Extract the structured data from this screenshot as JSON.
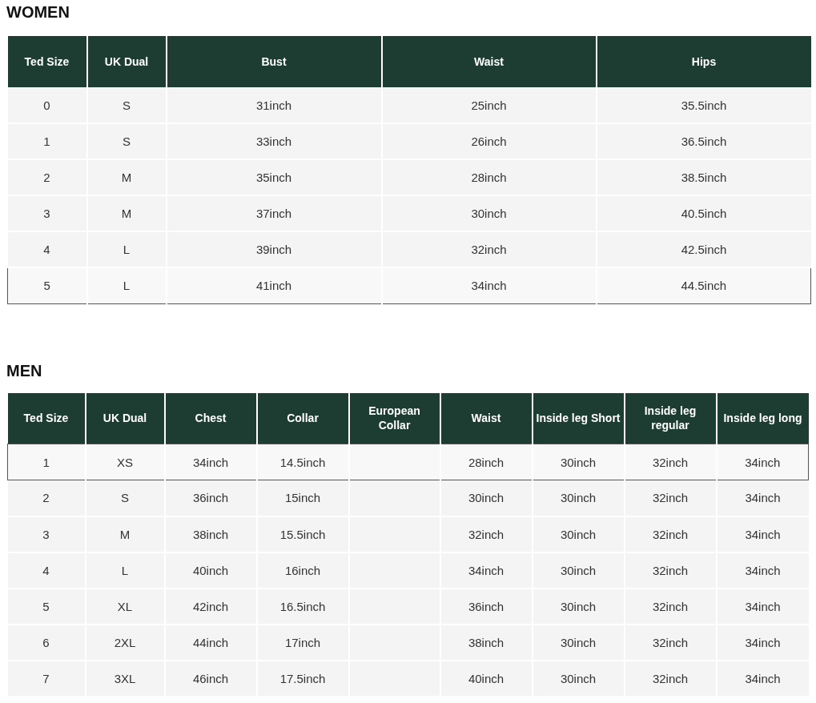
{
  "sections": [
    {
      "title": "WOMEN",
      "columns": [
        "Ted Size",
        "UK Dual",
        "Bust",
        "Waist",
        "Hips"
      ],
      "rows": [
        {
          "highlighted": false,
          "cells": [
            "0",
            "S",
            "31inch",
            "25inch",
            "35.5inch"
          ]
        },
        {
          "highlighted": false,
          "cells": [
            "1",
            "S",
            "33inch",
            "26inch",
            "36.5inch"
          ]
        },
        {
          "highlighted": false,
          "cells": [
            "2",
            "M",
            "35inch",
            "28inch",
            "38.5inch"
          ]
        },
        {
          "highlighted": false,
          "cells": [
            "3",
            "M",
            "37inch",
            "30inch",
            "40.5inch"
          ]
        },
        {
          "highlighted": false,
          "cells": [
            "4",
            "L",
            "39inch",
            "32inch",
            "42.5inch"
          ]
        },
        {
          "highlighted": true,
          "cells": [
            "5",
            "L",
            "41inch",
            "34inch",
            "44.5inch"
          ]
        }
      ]
    },
    {
      "title": "MEN",
      "columns": [
        "Ted Size",
        "UK Dual",
        "Chest",
        "Collar",
        "European Collar",
        "Waist",
        "Inside leg Short",
        "Inside leg regular",
        "Inside leg long"
      ],
      "rows": [
        {
          "highlighted": true,
          "cells": [
            "1",
            "XS",
            "34inch",
            "14.5inch",
            null,
            "28inch",
            "30inch",
            "32inch",
            "34inch"
          ]
        },
        {
          "highlighted": false,
          "cells": [
            "2",
            "S",
            "36inch",
            "15inch",
            null,
            "30inch",
            "30inch",
            "32inch",
            "34inch"
          ]
        },
        {
          "highlighted": false,
          "cells": [
            "3",
            "M",
            "38inch",
            "15.5inch",
            null,
            "32inch",
            "30inch",
            "32inch",
            "34inch"
          ]
        },
        {
          "highlighted": false,
          "cells": [
            "4",
            "L",
            "40inch",
            "16inch",
            null,
            "34inch",
            "30inch",
            "32inch",
            "34inch"
          ]
        },
        {
          "highlighted": false,
          "cells": [
            "5",
            "XL",
            "42inch",
            "16.5inch",
            null,
            "36inch",
            "30inch",
            "32inch",
            "34inch"
          ]
        },
        {
          "highlighted": false,
          "cells": [
            "6",
            "2XL",
            "44inch",
            "17inch",
            null,
            "38inch",
            "30inch",
            "32inch",
            "34inch"
          ]
        },
        {
          "highlighted": false,
          "cells": [
            "7",
            "3XL",
            "46inch",
            "17.5inch",
            null,
            "40inch",
            "30inch",
            "32inch",
            "34inch"
          ]
        }
      ]
    }
  ]
}
